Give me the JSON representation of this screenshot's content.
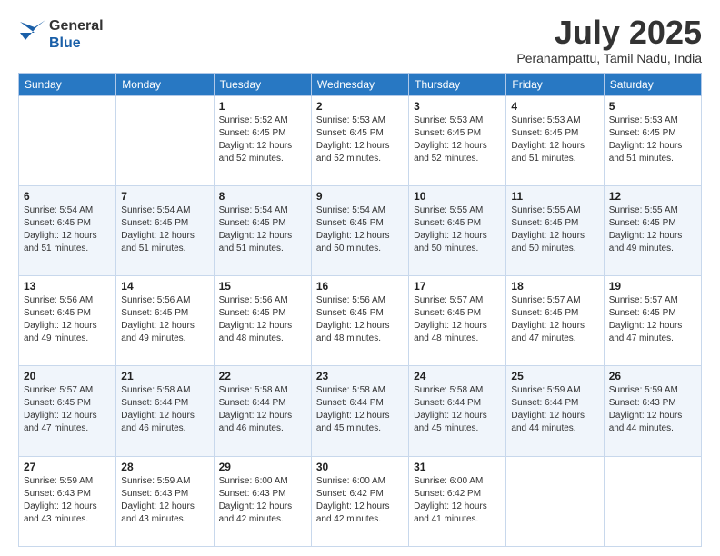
{
  "header": {
    "logo_general": "General",
    "logo_blue": "Blue",
    "title": "July 2025",
    "location": "Peranampattu, Tamil Nadu, India"
  },
  "days_of_week": [
    "Sunday",
    "Monday",
    "Tuesday",
    "Wednesday",
    "Thursday",
    "Friday",
    "Saturday"
  ],
  "weeks": [
    [
      {
        "day": "",
        "info": ""
      },
      {
        "day": "",
        "info": ""
      },
      {
        "day": "1",
        "info": "Sunrise: 5:52 AM\nSunset: 6:45 PM\nDaylight: 12 hours and 52 minutes."
      },
      {
        "day": "2",
        "info": "Sunrise: 5:53 AM\nSunset: 6:45 PM\nDaylight: 12 hours and 52 minutes."
      },
      {
        "day": "3",
        "info": "Sunrise: 5:53 AM\nSunset: 6:45 PM\nDaylight: 12 hours and 52 minutes."
      },
      {
        "day": "4",
        "info": "Sunrise: 5:53 AM\nSunset: 6:45 PM\nDaylight: 12 hours and 51 minutes."
      },
      {
        "day": "5",
        "info": "Sunrise: 5:53 AM\nSunset: 6:45 PM\nDaylight: 12 hours and 51 minutes."
      }
    ],
    [
      {
        "day": "6",
        "info": "Sunrise: 5:54 AM\nSunset: 6:45 PM\nDaylight: 12 hours and 51 minutes."
      },
      {
        "day": "7",
        "info": "Sunrise: 5:54 AM\nSunset: 6:45 PM\nDaylight: 12 hours and 51 minutes."
      },
      {
        "day": "8",
        "info": "Sunrise: 5:54 AM\nSunset: 6:45 PM\nDaylight: 12 hours and 51 minutes."
      },
      {
        "day": "9",
        "info": "Sunrise: 5:54 AM\nSunset: 6:45 PM\nDaylight: 12 hours and 50 minutes."
      },
      {
        "day": "10",
        "info": "Sunrise: 5:55 AM\nSunset: 6:45 PM\nDaylight: 12 hours and 50 minutes."
      },
      {
        "day": "11",
        "info": "Sunrise: 5:55 AM\nSunset: 6:45 PM\nDaylight: 12 hours and 50 minutes."
      },
      {
        "day": "12",
        "info": "Sunrise: 5:55 AM\nSunset: 6:45 PM\nDaylight: 12 hours and 49 minutes."
      }
    ],
    [
      {
        "day": "13",
        "info": "Sunrise: 5:56 AM\nSunset: 6:45 PM\nDaylight: 12 hours and 49 minutes."
      },
      {
        "day": "14",
        "info": "Sunrise: 5:56 AM\nSunset: 6:45 PM\nDaylight: 12 hours and 49 minutes."
      },
      {
        "day": "15",
        "info": "Sunrise: 5:56 AM\nSunset: 6:45 PM\nDaylight: 12 hours and 48 minutes."
      },
      {
        "day": "16",
        "info": "Sunrise: 5:56 AM\nSunset: 6:45 PM\nDaylight: 12 hours and 48 minutes."
      },
      {
        "day": "17",
        "info": "Sunrise: 5:57 AM\nSunset: 6:45 PM\nDaylight: 12 hours and 48 minutes."
      },
      {
        "day": "18",
        "info": "Sunrise: 5:57 AM\nSunset: 6:45 PM\nDaylight: 12 hours and 47 minutes."
      },
      {
        "day": "19",
        "info": "Sunrise: 5:57 AM\nSunset: 6:45 PM\nDaylight: 12 hours and 47 minutes."
      }
    ],
    [
      {
        "day": "20",
        "info": "Sunrise: 5:57 AM\nSunset: 6:45 PM\nDaylight: 12 hours and 47 minutes."
      },
      {
        "day": "21",
        "info": "Sunrise: 5:58 AM\nSunset: 6:44 PM\nDaylight: 12 hours and 46 minutes."
      },
      {
        "day": "22",
        "info": "Sunrise: 5:58 AM\nSunset: 6:44 PM\nDaylight: 12 hours and 46 minutes."
      },
      {
        "day": "23",
        "info": "Sunrise: 5:58 AM\nSunset: 6:44 PM\nDaylight: 12 hours and 45 minutes."
      },
      {
        "day": "24",
        "info": "Sunrise: 5:58 AM\nSunset: 6:44 PM\nDaylight: 12 hours and 45 minutes."
      },
      {
        "day": "25",
        "info": "Sunrise: 5:59 AM\nSunset: 6:44 PM\nDaylight: 12 hours and 44 minutes."
      },
      {
        "day": "26",
        "info": "Sunrise: 5:59 AM\nSunset: 6:43 PM\nDaylight: 12 hours and 44 minutes."
      }
    ],
    [
      {
        "day": "27",
        "info": "Sunrise: 5:59 AM\nSunset: 6:43 PM\nDaylight: 12 hours and 43 minutes."
      },
      {
        "day": "28",
        "info": "Sunrise: 5:59 AM\nSunset: 6:43 PM\nDaylight: 12 hours and 43 minutes."
      },
      {
        "day": "29",
        "info": "Sunrise: 6:00 AM\nSunset: 6:43 PM\nDaylight: 12 hours and 42 minutes."
      },
      {
        "day": "30",
        "info": "Sunrise: 6:00 AM\nSunset: 6:42 PM\nDaylight: 12 hours and 42 minutes."
      },
      {
        "day": "31",
        "info": "Sunrise: 6:00 AM\nSunset: 6:42 PM\nDaylight: 12 hours and 41 minutes."
      },
      {
        "day": "",
        "info": ""
      },
      {
        "day": "",
        "info": ""
      }
    ]
  ]
}
